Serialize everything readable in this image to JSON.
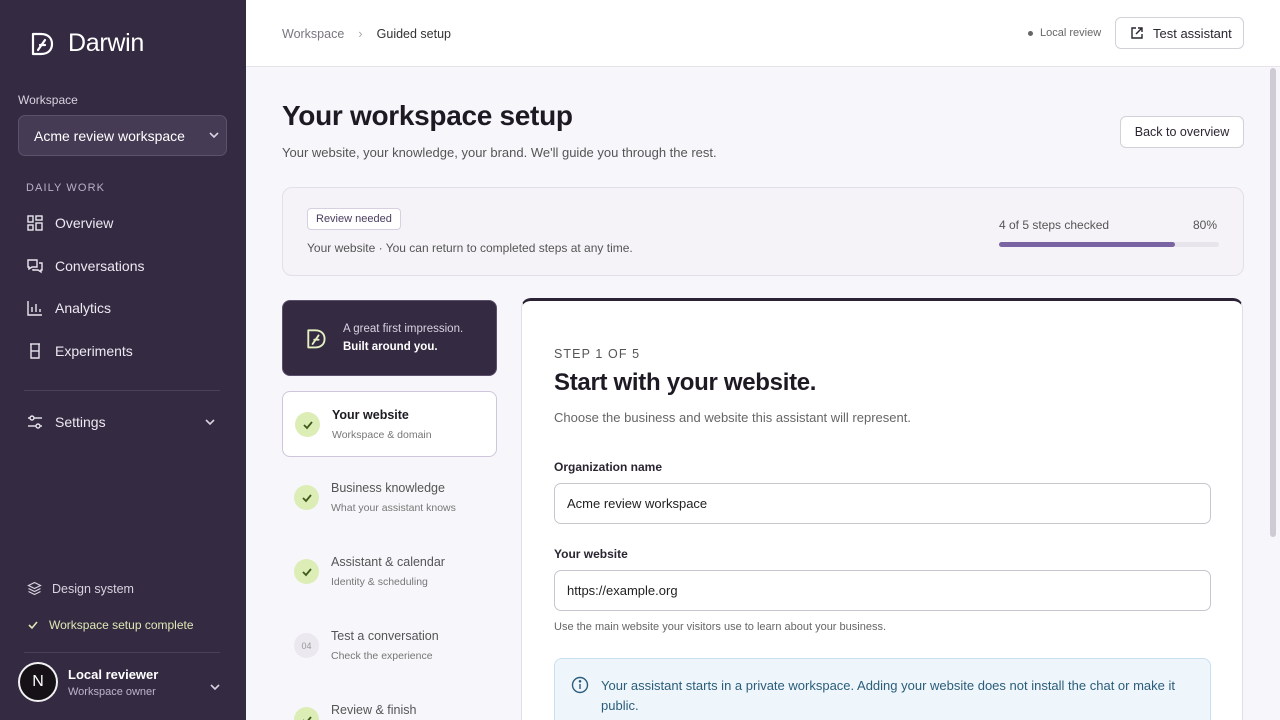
{
  "app": {
    "brand": "Darwin"
  },
  "sidebar": {
    "workspace_label": "Workspace",
    "workspace_value": "Acme review workspace",
    "section_label": "DAILY WORK",
    "items": [
      {
        "label": "Overview",
        "icon": "grid-icon"
      },
      {
        "label": "Conversations",
        "icon": "chat-icon"
      },
      {
        "label": "Analytics",
        "icon": "bar-chart-icon"
      },
      {
        "label": "Experiments",
        "icon": "flask-icon"
      }
    ],
    "settings_label": "Settings",
    "design_system": "Design system",
    "setup_status": "Workspace setup complete",
    "user": {
      "initial": "N",
      "name": "Local reviewer",
      "role": "Workspace owner"
    }
  },
  "topbar": {
    "breadcrumb": [
      "Workspace",
      "Guided setup"
    ],
    "status": "Local review",
    "test_button": "Test assistant"
  },
  "header": {
    "title": "Your workspace setup",
    "subtitle": "Your website, your knowledge, your brand. We'll guide you through the rest.",
    "back_button": "Back to overview"
  },
  "progress": {
    "badge": "Review needed",
    "note": "Your website · You can return to completed steps at any time.",
    "steps_checked": "4 of 5 steps checked",
    "percent_label": "80%",
    "fraction": 0.8
  },
  "promo": {
    "line1": "A great first impression.",
    "line2": "Built around you."
  },
  "steps": [
    {
      "title": "Your website",
      "subtitle": "Workspace & domain",
      "done": true
    },
    {
      "title": "Business knowledge",
      "subtitle": "What your assistant knows",
      "done": true
    },
    {
      "title": "Assistant & calendar",
      "subtitle": "Identity & scheduling",
      "done": true
    },
    {
      "title": "Test a conversation",
      "subtitle": "Check the experience",
      "number": "04"
    },
    {
      "title": "Review & finish",
      "done": true
    }
  ],
  "form": {
    "kicker": "STEP 1 OF 5",
    "title": "Start with your website.",
    "subtitle": "Choose the business and website this assistant will represent.",
    "org_label": "Organization name",
    "org_value": "Acme review workspace",
    "website_label": "Your website",
    "website_value": "https://example.org",
    "hint": "Use the main website your visitors use to learn about your business.",
    "info": "Your assistant starts in a private workspace. Adding your website does not install the chat or make it public."
  },
  "colors": {
    "sidebar_bg": "#342a42",
    "accent": "#7a63a3",
    "check_bg": "#dcedb6"
  }
}
